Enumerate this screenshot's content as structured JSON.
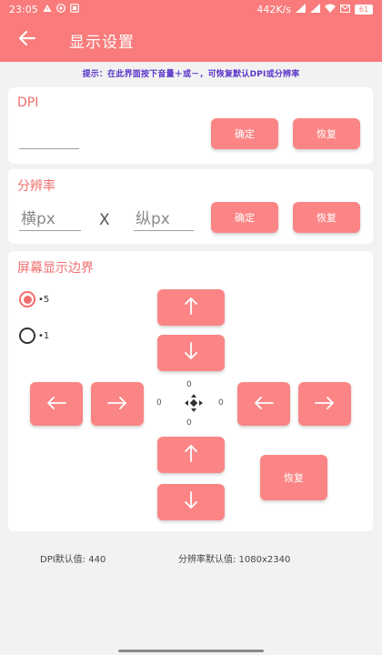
{
  "status_bar": {
    "time": "23:05",
    "network_speed": "442K/s",
    "battery": "61",
    "left_icons": [
      "warning-icon",
      "vpn-icon",
      "app-icon"
    ],
    "right_icons": [
      "signal-icon",
      "signal-icon",
      "wifi-icon",
      "mail-icon",
      "battery-icon"
    ]
  },
  "app_bar": {
    "title": "显示设置",
    "back_icon": "arrow-left-icon"
  },
  "tip": "提示：在此界面按下音量＋或－，可恢复默认DPI或分辨率",
  "dpi_section": {
    "title": "DPI",
    "input_value": "",
    "confirm_label": "确定",
    "restore_label": "恢复"
  },
  "resolution_section": {
    "title": "分辨率",
    "width_placeholder": "横px",
    "separator": "X",
    "height_placeholder": "纵px",
    "confirm_label": "确定",
    "restore_label": "恢复"
  },
  "border_section": {
    "title": "屏幕显示边界",
    "step_options": [
      {
        "label": "•5",
        "selected": true
      },
      {
        "label": "•1",
        "selected": false
      }
    ],
    "offsets": {
      "top": "0",
      "left": "0",
      "right": "0",
      "bottom": "0"
    },
    "restore_label": "恢复",
    "center_icon": "move-arrows-icon"
  },
  "footer": {
    "dpi_default": "DPI默认值: 440",
    "resolution_default": "分辨率默认值: 1080x2340"
  },
  "colors": {
    "accent": "#f97b7b",
    "button": "#fb8585",
    "section_title": "#f06d6d",
    "tip_text": "#5a36c9",
    "background": "#f2f2f2"
  }
}
